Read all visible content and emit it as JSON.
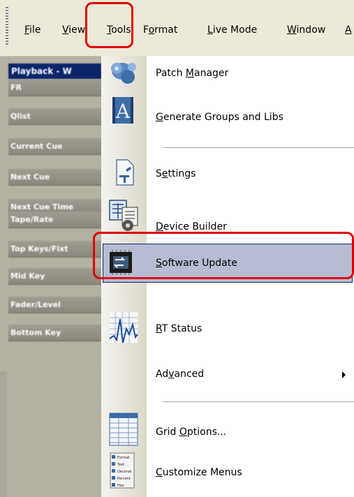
{
  "menubar": {
    "items": [
      {
        "pre": "",
        "u": "F",
        "post": "ile"
      },
      {
        "pre": "",
        "u": "V",
        "post": "iew"
      },
      {
        "pre": "",
        "u": "T",
        "post": "ools"
      },
      {
        "pre": "F",
        "u": "o",
        "post": "rmat"
      },
      {
        "pre": "",
        "u": "L",
        "post": "ive Mode"
      },
      {
        "pre": "",
        "u": "W",
        "post": "indow"
      },
      {
        "pre": "",
        "u": "A",
        "post": ""
      }
    ]
  },
  "left_pane": {
    "title": "Playback - W",
    "rows": [
      "FR",
      "Qlist",
      "Current Cue",
      "Next Cue",
      "Next Cue Time",
      "Tape/Rate",
      "Top Keys/Fixt",
      "Mid Key",
      "Fader/Level",
      "Bottom Key"
    ]
  },
  "tools_menu": {
    "items": [
      {
        "pre": "Patch ",
        "u": "M",
        "post": "anager",
        "icon": "patch-manager-icon"
      },
      {
        "pre": "",
        "u": "G",
        "post": "enerate Groups and Libs",
        "icon": "generate-groups-icon"
      },
      {
        "pre": "S",
        "u": "e",
        "post": "ttings",
        "icon": "settings-icon"
      },
      {
        "pre": "",
        "u": "D",
        "post": "evice Builder",
        "icon": "device-builder-icon"
      },
      {
        "pre": "",
        "u": "S",
        "post": "oftware Update",
        "icon": "software-update-icon"
      },
      {
        "pre": "",
        "u": "R",
        "post": "T Status",
        "icon": "rt-status-icon"
      },
      {
        "pre": "Ad",
        "u": "v",
        "post": "anced",
        "icon": ""
      },
      {
        "pre": "Grid ",
        "u": "O",
        "post": "ptions...",
        "icon": "grid-options-icon"
      },
      {
        "pre": "",
        "u": "C",
        "post": "ustomize Menus",
        "icon": "customize-menus-icon"
      }
    ]
  },
  "format_icon_text": [
    "Format",
    "Text",
    "Decimal",
    "Percent",
    "Hex"
  ],
  "colors": {
    "highlight_red": "#e00000",
    "selection": "#b6bdd2",
    "menubar": "#ece9d8"
  }
}
